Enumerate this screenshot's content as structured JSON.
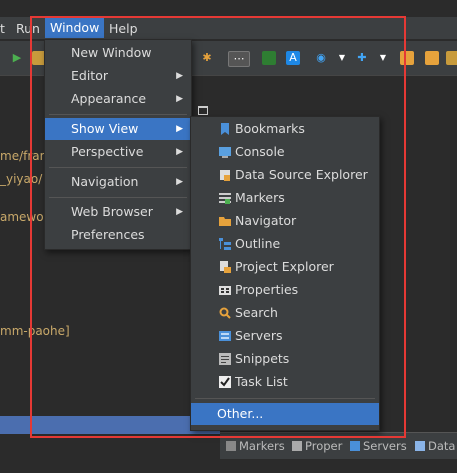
{
  "menubar": {
    "items": [
      {
        "label": "t"
      },
      {
        "label": "Run"
      },
      {
        "label": "Window"
      },
      {
        "label": "Help"
      }
    ]
  },
  "editor": {
    "lines": [
      "me/fram",
      "_yiyao/",
      "amewor",
      "mm-paohe]"
    ]
  },
  "window_menu": {
    "items": [
      {
        "label": "New Window",
        "submenu": false
      },
      {
        "label": "Editor",
        "submenu": true
      },
      {
        "label": "Appearance",
        "submenu": true
      },
      {
        "label": "Show View",
        "submenu": true,
        "selected": true
      },
      {
        "label": "Perspective",
        "submenu": true
      },
      {
        "label": "Navigation",
        "submenu": true
      },
      {
        "label": "Web Browser",
        "submenu": true
      },
      {
        "label": "Preferences",
        "submenu": false
      }
    ]
  },
  "show_view_menu": {
    "items": [
      {
        "label": "Bookmarks",
        "icon": "bookmark-icon"
      },
      {
        "label": "Console",
        "icon": "console-icon"
      },
      {
        "label": "Data Source Explorer",
        "icon": "database-icon"
      },
      {
        "label": "Markers",
        "icon": "markers-icon"
      },
      {
        "label": "Navigator",
        "icon": "folder-icon"
      },
      {
        "label": "Outline",
        "icon": "outline-icon"
      },
      {
        "label": "Project Explorer",
        "icon": "project-explorer-icon"
      },
      {
        "label": "Properties",
        "icon": "properties-icon"
      },
      {
        "label": "Search",
        "icon": "search-icon"
      },
      {
        "label": "Servers",
        "icon": "server-icon"
      },
      {
        "label": "Snippets",
        "icon": "snippets-icon"
      },
      {
        "label": "Task List",
        "icon": "task-list-icon"
      },
      {
        "label": "Other...",
        "icon": "",
        "selected": true
      }
    ]
  },
  "bottom_tabs": [
    {
      "label": "Markers"
    },
    {
      "label": "Proper"
    },
    {
      "label": "Servers"
    },
    {
      "label": "Data S"
    }
  ],
  "colors": {
    "highlight": "#3a75c4",
    "annotation": "#e53935"
  }
}
